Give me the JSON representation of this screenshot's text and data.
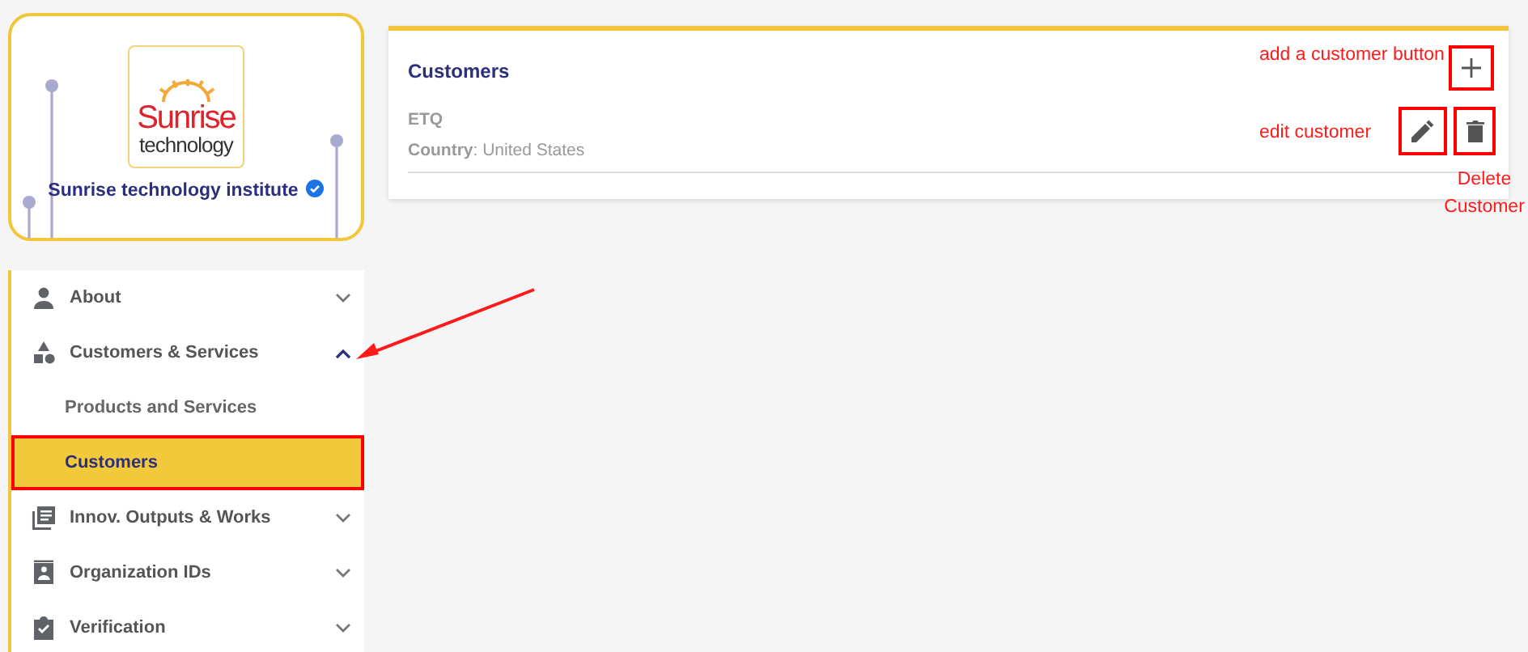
{
  "profile": {
    "logo_lines": [
      "Sunrise",
      "technology"
    ],
    "name": "Sunrise technology institute",
    "verified": true
  },
  "menu": [
    {
      "label": "About",
      "expanded": false
    },
    {
      "label": "Customers & Services",
      "expanded": true,
      "children": [
        {
          "label": "Products and Services",
          "selected": false,
          "highlighted": false
        },
        {
          "label": "Customers",
          "selected": true,
          "highlighted": true
        }
      ]
    },
    {
      "label": "Innov. Outputs & Works",
      "expanded": false
    },
    {
      "label": "Organization IDs",
      "expanded": false
    },
    {
      "label": "Verification",
      "expanded": false
    }
  ],
  "panel": {
    "title": "Customers",
    "add_highlighted": true,
    "customers": [
      {
        "name": "ETQ",
        "country_label": "Country",
        "country": ": United States",
        "edit_highlighted": true,
        "delete_highlighted": true
      }
    ]
  },
  "annotations": [
    {
      "kind": "add",
      "text": "add a customer button"
    },
    {
      "kind": "edit",
      "text": "edit customer"
    },
    {
      "kind": "delete",
      "text": "Delete Customer"
    },
    {
      "kind": "arrow"
    }
  ]
}
